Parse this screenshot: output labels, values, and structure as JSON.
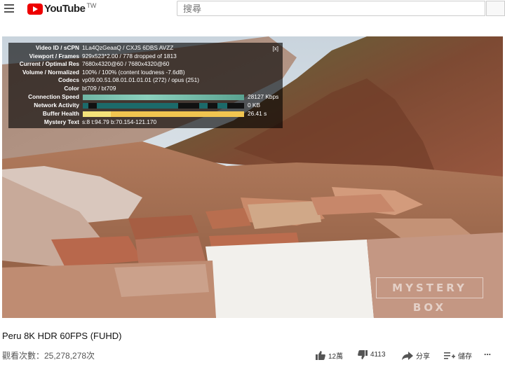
{
  "header": {
    "logo_text": "YouTube",
    "region": "TW",
    "search_placeholder": "搜尋",
    "brand_color": "#ff0000"
  },
  "player": {
    "stats": {
      "close_label": "[x]",
      "rows": [
        {
          "label": "Video ID / sCPN",
          "value": "1La4QzGeaaQ / CXJS 6DBS AVZZ"
        },
        {
          "label": "Viewport / Frames",
          "value": "929x523*2.00 / 778 dropped of 1813"
        },
        {
          "label": "Current / Optimal Res",
          "value": "7680x4320@60 / 7680x4320@60"
        },
        {
          "label": "Volume / Normalized",
          "value": "100% / 100% (content loudness -7.6dB)"
        },
        {
          "label": "Codecs",
          "value": "vp09.00.51.08.01.01.01.01 (272) / opus (251)"
        },
        {
          "label": "Color",
          "value": "bt709 / bt709"
        }
      ],
      "connection_speed": {
        "label": "Connection Speed",
        "value": "28127 Kbps"
      },
      "network_activity": {
        "label": "Network Activity",
        "value": "0 KB"
      },
      "buffer_health": {
        "label": "Buffer Health",
        "value": "26.41 s"
      },
      "mystery_text": {
        "label": "Mystery Text",
        "value": "s:8 t:94.79 b:70.154-121.170"
      }
    },
    "watermark": "MYSTERY BOX"
  },
  "video": {
    "title": "Peru 8K HDR 60FPS (FUHD)",
    "views": "觀看次數：25,278,278次",
    "likes": "12萬",
    "dislikes": "4113",
    "share_label": "分享",
    "save_label": "儲存",
    "more_label": "..."
  }
}
